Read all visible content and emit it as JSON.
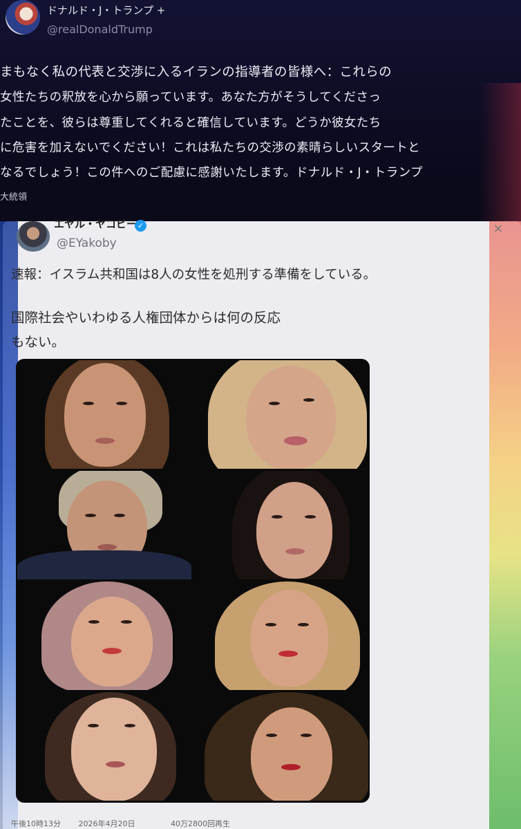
{
  "top_post": {
    "display_name": "ドナルド・J・トランプ",
    "name_suffix": "+",
    "handle": "@realDonaldTrump",
    "lines": [
      "まもなく私の代表と交渉に入るイランの指導者の皆様へ：これらの",
      "女性たちの釈放を心から願っています。あなた方がそうしてくださっ",
      "たことを、彼らは尊重してくれると確信しています。どうか彼女たち",
      "に危害を加えないでください！これは私たちの交渉の素晴らしいスタートと",
      "なるでしょう！この件へのご配慮に感謝いたします。ドナルド・J・トランプ"
    ],
    "signature_tail": "大統領"
  },
  "quoted_post": {
    "display_name": "エヤル・ヤコビー",
    "handle": "@EYakoby",
    "line1": "速報：イスラム共和国は8人の女性を処刑する準備をしている。",
    "line2": "国際社会やいわゆる人権団体からは何の反応",
    "line3": "もない。",
    "photo_count": 8
  },
  "footer": {
    "time": "午後10時13分",
    "date": "2026年4月20日",
    "views": "40万2800回再生"
  },
  "colors": {
    "top_bg": "#131233",
    "card_bg": "#ededf1",
    "verified": "#1d9bf0"
  },
  "icons": [
    "verified-badge-icon",
    "close-icon"
  ]
}
